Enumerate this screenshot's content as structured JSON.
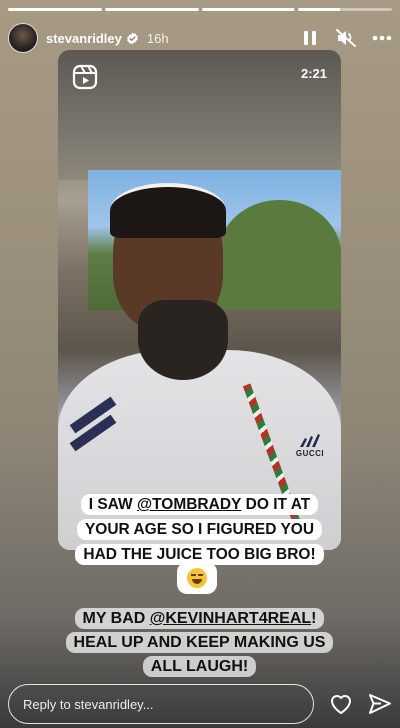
{
  "story": {
    "progress": [
      1,
      1,
      0.99,
      0.45,
      0
    ],
    "username": "stevanridley",
    "time_ago": "16h"
  },
  "video": {
    "duration": "2:21",
    "hoodie_brand": "GUCCI"
  },
  "caption_top": {
    "pre": "I saw ",
    "mention": "@TomBrady",
    "post": " do it at your age so I figured you had the juice too big bro!"
  },
  "caption_bottom": {
    "pre": "My bad ",
    "mention": "@kevinhart4real",
    "post": "! Heal up and keep making us all laugh!"
  },
  "emoji": "laughing-crying-face",
  "footer": {
    "reply_placeholder": "Reply to stevanridley..."
  },
  "icons": {
    "header": [
      "pause-icon",
      "mute-icon",
      "more-icon"
    ],
    "footer": [
      "heart-icon",
      "send-icon"
    ]
  }
}
